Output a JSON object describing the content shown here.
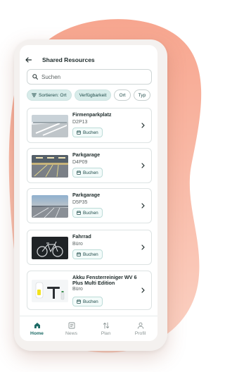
{
  "header": {
    "title": "Shared Resources"
  },
  "search": {
    "placeholder": "Suchen"
  },
  "filters": [
    {
      "label": "Sortieren: Ort",
      "selected": true,
      "icon": "sort-icon"
    },
    {
      "label": "Verfügbarkeit",
      "selected": true
    },
    {
      "label": "Ort",
      "selected": false
    },
    {
      "label": "Typ",
      "selected": false
    }
  ],
  "resources": [
    {
      "name": "Firmenparkplatz",
      "code": "D2P13",
      "action": "Buchen",
      "image": "parking-lot-photo"
    },
    {
      "name": "Parkgarage",
      "code": "D4P09",
      "action": "Buchen",
      "image": "parking-garage-photo"
    },
    {
      "name": "Parkgarage",
      "code": "D5P35",
      "action": "Buchen",
      "image": "rooftop-parking-photo"
    },
    {
      "name": "Fahrrad",
      "code": "Büro",
      "action": "Buchen",
      "image": "bicycle-photo"
    },
    {
      "name": "Akku Fensterreiniger WV 6 Plus Multi Edition",
      "code": "Büro",
      "action": "Buchen",
      "image": "window-cleaner-photo"
    }
  ],
  "nav": [
    {
      "label": "Home",
      "icon": "home-icon",
      "active": true
    },
    {
      "label": "News",
      "icon": "news-icon",
      "active": false
    },
    {
      "label": "Plan",
      "icon": "plan-icon",
      "active": false
    },
    {
      "label": "Profil",
      "icon": "profile-icon",
      "active": false
    }
  ],
  "colors": {
    "accent": "#1d6b66",
    "chip_selected_bg": "#d8ecea",
    "blob": "#f7b9a6",
    "phone_frame": "#f4f1ef"
  }
}
